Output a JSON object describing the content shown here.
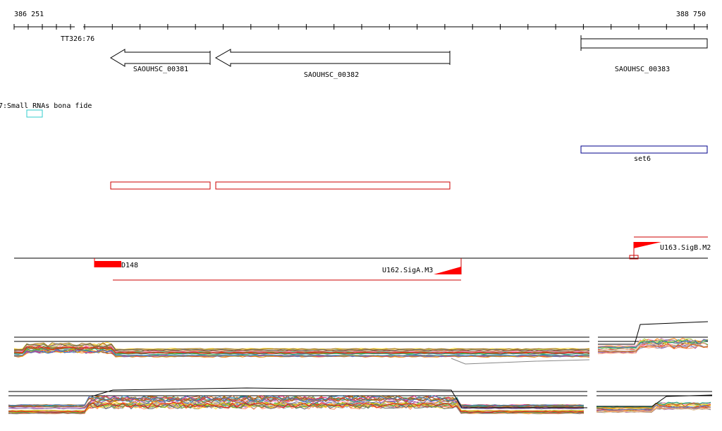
{
  "browser": {
    "coord_start": "386 251",
    "coord_end": "388 750",
    "track_label_tt": "TT326:76",
    "track_label_srna": "7:Small RNAs bona fide"
  },
  "genes": [
    {
      "name": "SAOUHSC_00381",
      "strand": "-"
    },
    {
      "name": "SAOUHSC_00382",
      "strand": "-"
    },
    {
      "name": "SAOUHSC_00383",
      "strand": "+"
    }
  ],
  "features": {
    "set6_label": "set6",
    "d148_label": "D148",
    "sigA_label": "U162.SigA.M3",
    "sigB_label": "U163.SigB.M2"
  },
  "colors": {
    "axis": "#000000",
    "srna_box": "#33cccc",
    "set6_box": "#00008b",
    "cds_box": "#cc0000",
    "feature_red": "#ff0000"
  }
}
